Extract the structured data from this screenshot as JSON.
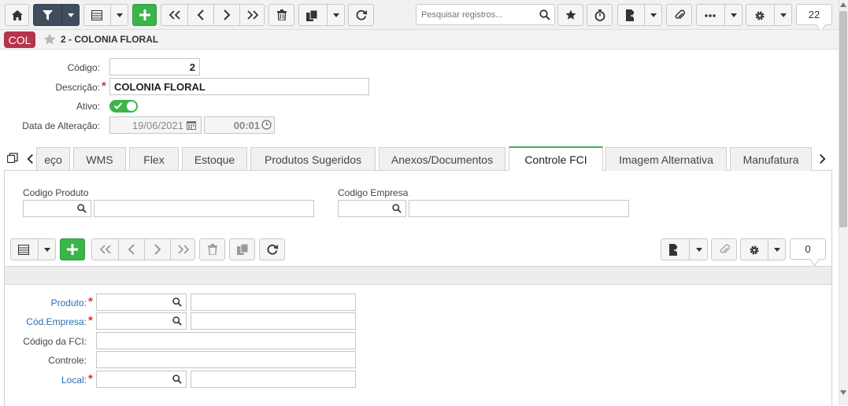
{
  "toolbar": {
    "search_placeholder": "Pesquisar registros...",
    "record_count": "22"
  },
  "header": {
    "badge": "COL",
    "title": "2 - COLONIA FLORAL"
  },
  "form": {
    "codigo_label": "Código:",
    "codigo_value": "2",
    "descricao_label": "Descrição:",
    "descricao_value": "COLONIA FLORAL",
    "ativo_label": "Ativo:",
    "data_label": "Data de Alteração:",
    "data_value": "19/06/2021",
    "hora_value": "00:01"
  },
  "tabs": [
    {
      "label": "eço"
    },
    {
      "label": "WMS"
    },
    {
      "label": "Flex"
    },
    {
      "label": "Estoque"
    },
    {
      "label": "Produtos Sugeridos"
    },
    {
      "label": "Anexos/Documentos"
    },
    {
      "label": "Controle FCI",
      "active": true
    },
    {
      "label": "Imagem Alternativa"
    },
    {
      "label": "Manufatura"
    }
  ],
  "filters": {
    "codigo_produto_label": "Codigo Produto",
    "codigo_empresa_label": "Codigo Empresa"
  },
  "subtoolbar": {
    "record_count": "0"
  },
  "detail": {
    "produto_label": "Produto:",
    "cod_empresa_label": "Cód.Empresa:",
    "codigo_fci_label": "Código da FCI:",
    "controle_label": "Controle:",
    "local_label": "Local:"
  },
  "colors": {
    "accent_green": "#3cb44b",
    "badge_red": "#b5344d",
    "dark_button": "#3f4d5c",
    "required_red": "#d9342b",
    "link_blue": "#2a6fb5"
  }
}
